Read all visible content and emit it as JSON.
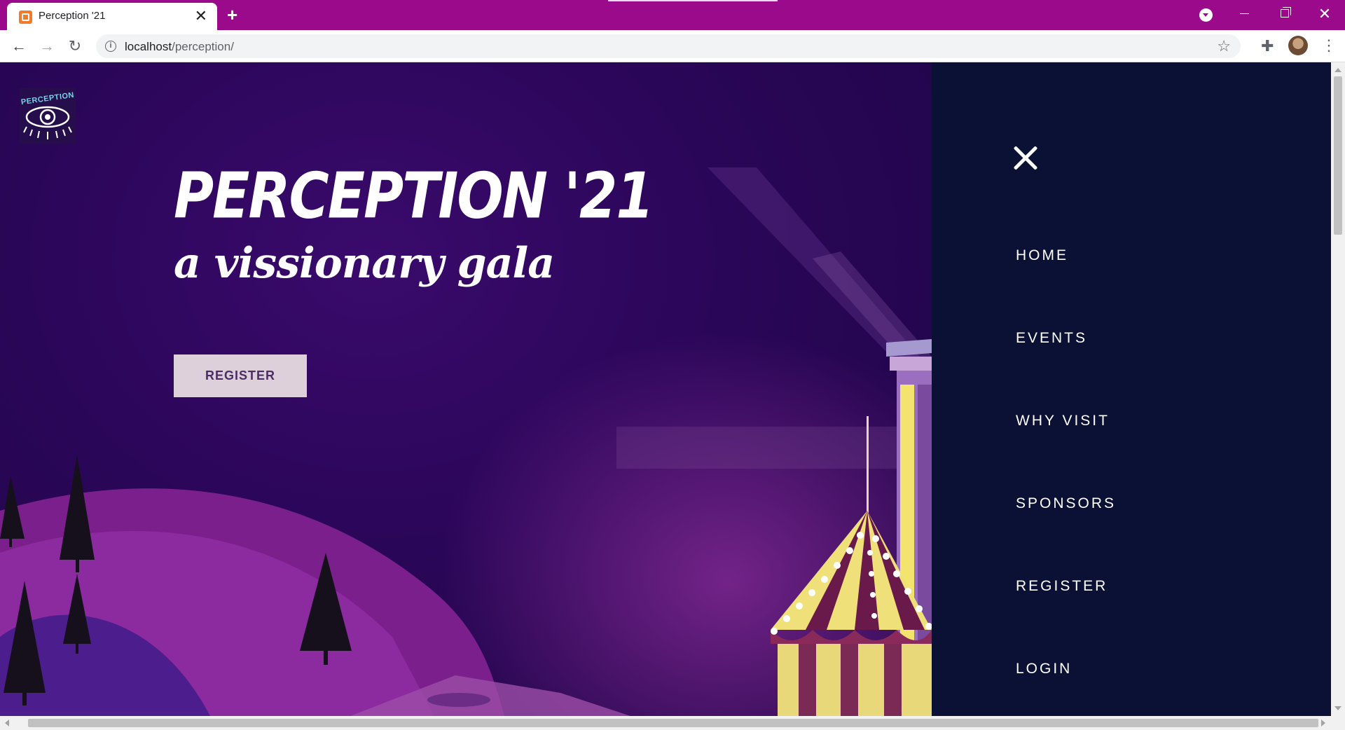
{
  "browser": {
    "tab_title": "Perception '21",
    "tab_close": "✕",
    "new_tab": "+",
    "url_host": "localhost",
    "url_path": "/perception/",
    "back_glyph": "←",
    "forward_glyph": "→",
    "reload_glyph": "↻",
    "info_glyph": "i",
    "star_glyph": "☆",
    "extensions_glyph": "✚",
    "menu_glyph": "⋮",
    "minimize_glyph": "",
    "maximize_glyph": "",
    "close_glyph": "✕",
    "accent_color": "#9c0a8c"
  },
  "hero": {
    "logo_text": "PERCEPTION",
    "title": "PERCEPTION '21",
    "subtitle": "a vissionary gala",
    "register_label": "REGISTER",
    "background_color": "#2a0658"
  },
  "sidenav": {
    "close_icon": "close-icon",
    "items": [
      {
        "label": "HOME"
      },
      {
        "label": "EVENTS"
      },
      {
        "label": "WHY VISIT"
      },
      {
        "label": "SPONSORS"
      },
      {
        "label": "REGISTER"
      },
      {
        "label": "LOGIN"
      }
    ],
    "background_color": "#0b1035"
  }
}
